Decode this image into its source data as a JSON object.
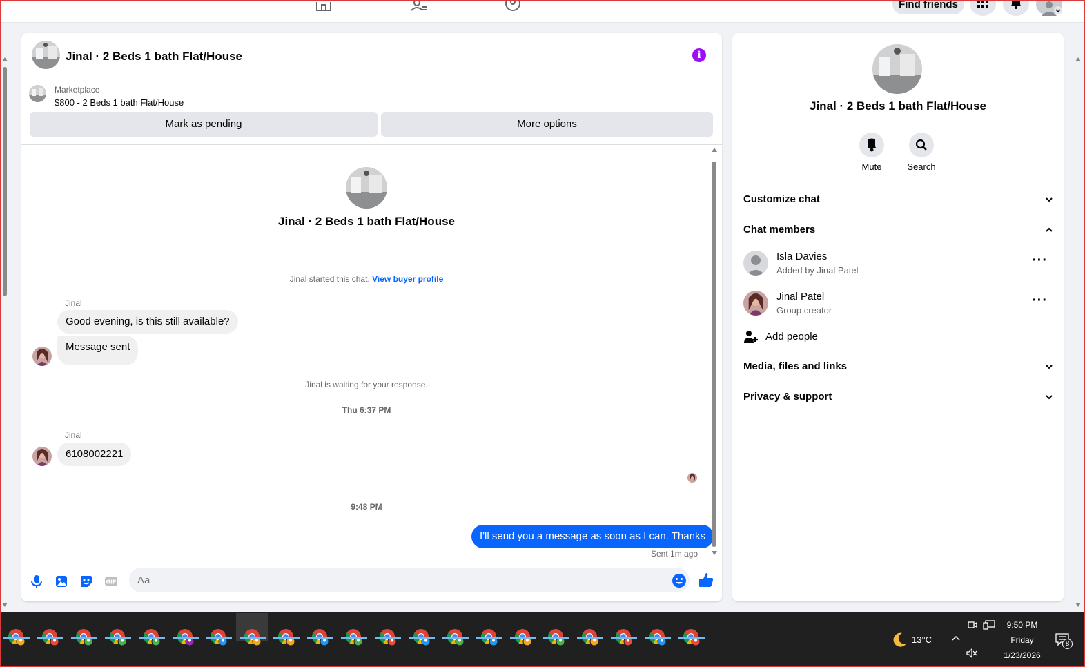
{
  "topbar": {
    "find_friends": "Find friends"
  },
  "chat": {
    "title": "Jinal · 2 Beds 1 bath Flat/House",
    "marketplace_label": "Marketplace",
    "listing": "$800 - 2 Beds 1 bath Flat/House",
    "mark_pending": "Mark as pending",
    "more_options": "More options",
    "intro_title": "Jinal · 2 Beds 1 bath Flat/House",
    "started_text": "Jinal started this chat.",
    "view_buyer_profile": "View buyer profile",
    "messages": [
      {
        "sender": "Jinal",
        "text": "Good evening, is this still available?"
      },
      {
        "text": "Message sent"
      },
      {
        "sender": "Jinal",
        "text": "6108002221"
      }
    ],
    "waiting_text": "Jinal is waiting for your response.",
    "time_1": "Thu 6:37 PM",
    "time_2": "9:48 PM",
    "outgoing": "I'll send you a message as soon as I can. Thanks",
    "sent_status": "Sent 1m ago",
    "input_placeholder": "Aa"
  },
  "info_panel": {
    "title": "Jinal · 2 Beds 1 bath Flat/House",
    "mute": "Mute",
    "search": "Search",
    "customize_chat": "Customize chat",
    "chat_members": "Chat members",
    "members": [
      {
        "name": "Isla Davies",
        "sub": "Added by Jinal Patel"
      },
      {
        "name": "Jinal Patel",
        "sub": "Group creator"
      }
    ],
    "add_people": "Add people",
    "media_files_links": "Media, files and links",
    "privacy_support": "Privacy & support"
  },
  "taskbar": {
    "weather": "13°C",
    "time": "9:50 PM",
    "day": "Friday",
    "date": "1/23/2026",
    "notifications": "8"
  },
  "colors": {
    "accent": "#0866ff",
    "info": "#9b0ff5",
    "taskbar": "#202020"
  }
}
